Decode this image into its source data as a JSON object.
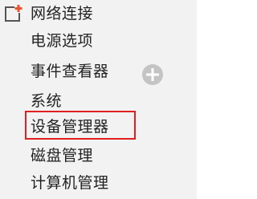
{
  "menu": {
    "items": [
      {
        "label": "网络连接"
      },
      {
        "label": "电源选项"
      },
      {
        "label": "事件查看器"
      },
      {
        "label": "系统"
      },
      {
        "label": "设备管理器"
      },
      {
        "label": "磁盘管理"
      },
      {
        "label": "计算机管理"
      }
    ],
    "highlighted_item": "设备管理器"
  },
  "icons": {
    "app_icon": "new-window-icon",
    "plus_icon": "plus-circle-icon"
  },
  "colors": {
    "highlight": "#e02020",
    "icon_accent": "#e8532f",
    "background": "#f2f2f2"
  }
}
